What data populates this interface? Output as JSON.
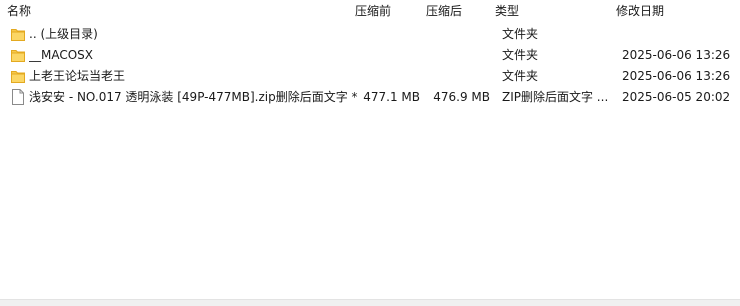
{
  "columns": {
    "name": "名称",
    "original_size": "压缩前",
    "compressed_size": "压缩后",
    "type": "类型",
    "modified": "修改日期"
  },
  "files": [
    {
      "name": ".. (上级目录)",
      "original_size": "",
      "compressed_size": "",
      "type": "文件夹",
      "modified": "",
      "icon": "folder-icon"
    },
    {
      "name": "__MACOSX",
      "original_size": "",
      "compressed_size": "",
      "type": "文件夹",
      "modified": "2025-06-06 13:26",
      "icon": "folder-icon"
    },
    {
      "name": "上老王论坛当老王",
      "original_size": "",
      "compressed_size": "",
      "type": "文件夹",
      "modified": "2025-06-06 13:26",
      "icon": "folder-icon"
    },
    {
      "name": "浅安安 - NO.017 透明泳装 [49P-477MB].zip删除后面文字 *",
      "original_size": "477.1 MB",
      "compressed_size": "476.9 MB",
      "type": "ZIP删除后面文字 ...",
      "modified": "2025-06-05 20:02",
      "icon": "file-icon"
    }
  ],
  "colors": {
    "folder": "#f7c94a",
    "folder_dark": "#e3a920",
    "file_border": "#8a8a8a"
  }
}
